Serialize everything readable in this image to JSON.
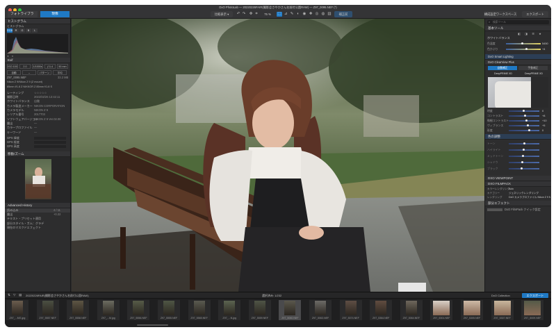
{
  "window": {
    "title": "DxO PhotoLab — 20220226FAIR(撮影会さやかさん名前付公園RAW) — Z97_0095.NEF (*)"
  },
  "toolbar": {
    "tab_browse": "フォトライブラリ",
    "tab_develop": "現像",
    "btn_compare": "比較表示 ▾",
    "zoom": "75 %",
    "btn_repair": "補正前",
    "btn_export_disk": "構成設定ワークスペース",
    "btn_export": "エクスポート"
  },
  "left_panel": {
    "histogram_title": "ヒストグラム",
    "histogram_label": "ヒストグラム",
    "hist_modes": [
      "RGB",
      "R",
      "G",
      "B",
      "L"
    ],
    "exif_title": "Exif",
    "exif_chips": [
      "ISO 100",
      "2.0",
      "1/1000s",
      "ƒ/1.4",
      "50 mm"
    ],
    "exif_chips2": [
      "自動",
      "↔",
      "パターン",
      "平均"
    ],
    "file_name": "Z97_0095.NEF",
    "file_size": "33.2 MB",
    "camera_line": "Nikon Z 9/Nikon Z 9 (Z mount)",
    "lens_line": "85mm f/1.8 Z NIKKOR Z 85mm f/1.8 S",
    "meta_rows": [
      {
        "label": "レーティング",
        "value": "☆☆☆☆☆"
      },
      {
        "label": "撮影日時",
        "value": "2022/02/26 13:42:11"
      },
      {
        "label": "ホワイトバランス",
        "value": "自動"
      },
      {
        "label": "カメラ製造メーカー",
        "value": "NIKON CORPORATION"
      },
      {
        "label": "カメラモデル",
        "value": "NIKON Z 9"
      },
      {
        "label": "シリアル番号",
        "value": "2017703"
      },
      {
        "label": "ソフトウェアバージョン",
        "value": "NIKON Z 9 Ver.02.00"
      },
      {
        "label": "露出",
        "value": "—"
      },
      {
        "label": "カラープロファイル",
        "value": "—"
      },
      {
        "label": "キーワード",
        "value": "—"
      }
    ],
    "gps_rows": [
      "GPS 緯度",
      "GPS 経度",
      "GPS 高度"
    ],
    "nav_title": "移動/ズーム",
    "history_title": "Advanced History",
    "history_rows": [
      {
        "label": "読み込み",
        "value": "4 / 11"
      },
      {
        "label": "露出",
        "value": "+0.32"
      },
      {
        "label": "テキスト・プリセット適用",
        "value": ""
      },
      {
        "label": "部分スタイル・ガム：グラデ",
        "value": ""
      },
      {
        "label": "現在のマスクドエフェクト",
        "value": ""
      }
    ]
  },
  "right_panel": {
    "search_placeholder": "検索ツール",
    "section_basic": "基本ツール",
    "section_wb": "ホワイトバランス",
    "wb_rows": [
      {
        "label": "色温度",
        "value": "5450"
      },
      {
        "label": "色かぶり",
        "value": "+4"
      }
    ],
    "section_smart": "DxO Smart Lighting",
    "section_clear": "DxO ClearView Plus",
    "tab_auto": "自動補正",
    "tab_manual": "手動補正",
    "sub_tabs": [
      "DeepPRIME XD",
      "DeepPRIME XD"
    ],
    "sliders": [
      {
        "label": "明度",
        "value": "0"
      },
      {
        "label": "コントラスト",
        "value": "+8"
      },
      {
        "label": "微細コントラスト",
        "value": "+10"
      },
      {
        "label": "ヴィブランス",
        "value": "+5"
      },
      {
        "label": "彩度",
        "value": "0"
      }
    ],
    "section_color": "色の調整",
    "color_rows": [
      "トーン",
      "ハイライト",
      "ミッドトーン",
      "シャドウ",
      "ブラック"
    ],
    "section_viewpoint": "DXO VIEWPOINT",
    "section_filmpack": "DXO FILMPACK",
    "filmpack_rows": [
      {
        "label": "カラーレンダリング",
        "value": "Auto"
      },
      {
        "label": "カテゴリー",
        "value": "ジェネリックレンダリング"
      },
      {
        "label": "レンダリング",
        "value": "DxO カメラプロファイル Nikon Z 9 NM"
      }
    ],
    "section_preset": "部分エフェクト",
    "preset_row": "DxO FilmPack クイック設定"
  },
  "bottom": {
    "path": "20220226FAIR(撮影会さやかさん名前付公園RAW)",
    "selection": "選択済み: 1/232",
    "collection_label": "DxO Collection",
    "export_label": "エクスポート",
    "thumbs": [
      "Z97_...MG.jpg",
      "Z97_5557.NEF",
      "Z97_5558.NEF",
      "Z97_...M.jpg",
      "Z97_5556.NEF",
      "Z97_5555.NEF",
      "Z97_5565.NEF",
      "Z97_...N.jpg",
      "Z97_5559.NEF",
      "Z97_5060.NEF",
      "Z97_5063.NEF",
      "Z97_5074.NEF",
      "Z97_5364.NEF",
      "Z97_5064.NEF",
      "Z97_5301.NEF",
      "Z97_5305.NEF",
      "Z97_5307.NEF",
      "Z97_5009.NEF"
    ]
  },
  "colors": {
    "accent": "#1f79c4",
    "panel": "#2d2d2e",
    "slider_warm": "#cc4a6a"
  }
}
